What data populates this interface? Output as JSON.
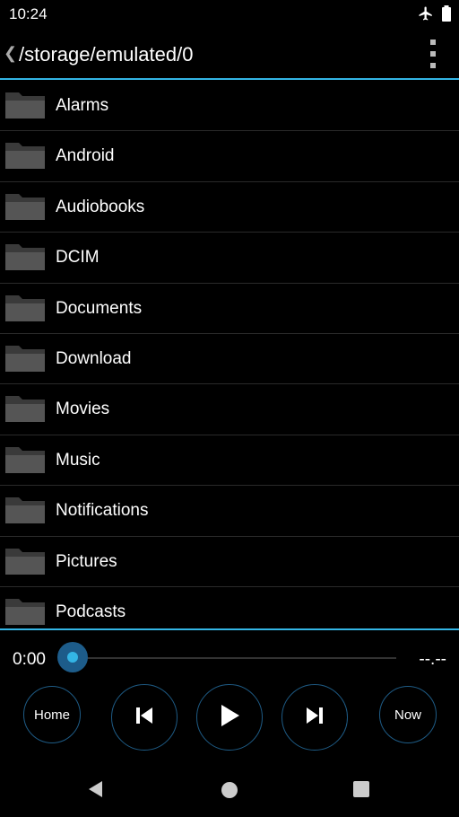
{
  "status_bar": {
    "time": "10:24",
    "icons": [
      "airplane-mode-icon",
      "battery-icon"
    ]
  },
  "app_bar": {
    "path": "/storage/emulated/0",
    "back_icon": "chevron-left-icon",
    "menu_icon": "overflow-menu-icon"
  },
  "files": [
    {
      "name": "Alarms"
    },
    {
      "name": "Android"
    },
    {
      "name": "Audiobooks"
    },
    {
      "name": "DCIM"
    },
    {
      "name": "Documents"
    },
    {
      "name": "Download"
    },
    {
      "name": "Movies"
    },
    {
      "name": "Music"
    },
    {
      "name": "Notifications"
    },
    {
      "name": "Pictures"
    },
    {
      "name": "Podcasts"
    }
  ],
  "player": {
    "elapsed": "0:00",
    "total": "--.--",
    "progress": 0,
    "home_label": "Home",
    "now_label": "Now"
  },
  "colors": {
    "accent": "#33b5e5",
    "button_ring": "#1e5b85",
    "background": "#000000"
  }
}
